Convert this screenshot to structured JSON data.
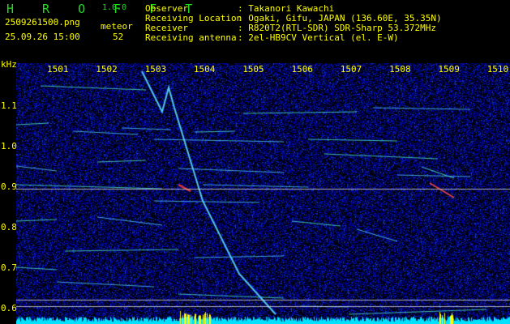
{
  "app": {
    "name": "H R O F F T",
    "version": "1.0.0"
  },
  "file": {
    "name": "2509261500.png",
    "datetime": "25.09.26 15:00"
  },
  "meteor": {
    "label": "meteor",
    "count": "52"
  },
  "info": [
    {
      "label": "Observer",
      "value": ": Takanori Kawachi"
    },
    {
      "label": "Receiving Location",
      "value": ": Ogaki, Gifu, JAPAN (136.60E, 35.35N)"
    },
    {
      "label": "Receiver",
      "value": ": R820T2(RTL-SDR) SDR-Sharp 53.372MHz"
    },
    {
      "label": "Receiving antenna",
      "value": ": 2el-HB9CV Vertical (el. E-W)"
    }
  ],
  "chart_data": {
    "type": "heatmap",
    "title": "HROFFT spectrogram",
    "ylabel": "kHz",
    "x_ticks": [
      "1501",
      "1502",
      "1503",
      "1504",
      "1505",
      "1506",
      "1507",
      "1508",
      "1509",
      "1510"
    ],
    "y_ticks": [
      "1.1",
      "1.0",
      "0.9",
      "0.8",
      "0.7",
      "0.6"
    ],
    "ylim": [
      0.58,
      1.19
    ],
    "colors": {
      "noise": "#0a1a9a",
      "signal": "#4fd8ff",
      "strong": "#ff4040",
      "bars": "#00e0ff",
      "bars_strong": "#ffff00"
    }
  }
}
